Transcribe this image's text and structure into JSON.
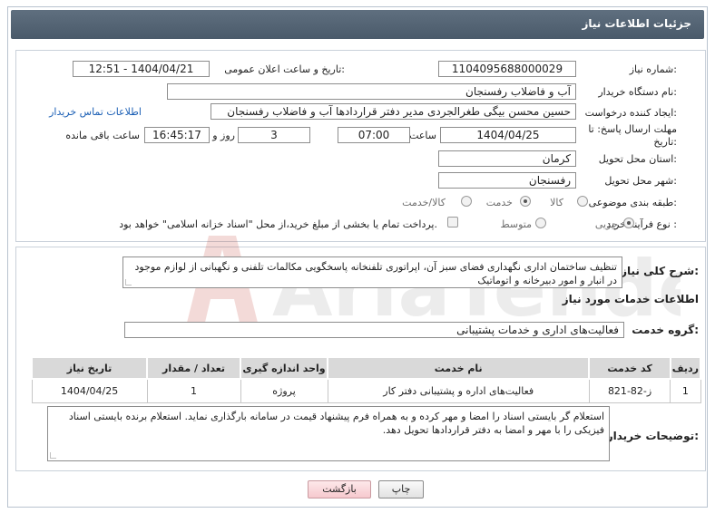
{
  "header": {
    "title": "جزئیات اطلاعات نیاز"
  },
  "form": {
    "need_number_label": "شماره نیاز:",
    "need_number": "1104095688000029",
    "announce_datetime_label": "تاریخ و ساعت اعلان عمومی:",
    "announce_datetime": "1404/04/21 - 12:51",
    "buyer_org_label": "نام دستگاه خریدار:",
    "buyer_org": "آب و فاضلاب رفسنجان",
    "requester_label": "ایجاد کننده درخواست:",
    "requester": "حسین محسن بیگی طغرالجردی مدیر دفتر قراردادها آب و فاضلاب رفسنجان",
    "contact_link": "اطلاعات تماس خریدار",
    "deadline_label": "مهلت ارسال پاسخ: تا تاریخ:",
    "deadline_date": "1404/04/25",
    "hour_label": "ساعت",
    "deadline_time": "07:00",
    "days_value": "3",
    "days_label": "روز و",
    "remaining_time": "16:45:17",
    "remaining_label": "ساعت باقی مانده",
    "province_label": "استان محل تحویل:",
    "province": "کرمان",
    "city_label": "شهر محل تحویل:",
    "city": "رفسنجان",
    "category_label": "طبقه بندی موضوعی:",
    "category_options": [
      "کالا",
      "خدمت",
      "کالا/خدمت"
    ],
    "category_selected": "خدمت",
    "process_label": "نوع فرآیند خرید :",
    "process_options": [
      "جزیی",
      "متوسط"
    ],
    "process_selected": "جزیی",
    "payment_note": "پرداخت تمام یا بخشی از مبلغ خرید،از محل \"اسناد خزانه اسلامی\" خواهد بود."
  },
  "summary": {
    "label": "شرح کلی نیاز:",
    "text": "تنظیف ساختمان اداری نگهداری فضای سبز آن، اپراتوری تلفنخانه پاسخگویی مکالمات تلفنی و نگهبانی از لوازم موجود در انبار و امور دبیرخانه و اتوماتیک"
  },
  "services": {
    "section_title": "اطلاعات خدمات مورد نیاز",
    "group_label": "گروه خدمت:",
    "group_value": "فعالیت‌های اداری و خدمات پشتیبانی",
    "table": {
      "headers": [
        "ردیف",
        "کد خدمت",
        "نام خدمت",
        "واحد اندازه گیری",
        "تعداد / مقدار",
        "تاریخ نیاز"
      ],
      "rows": [
        [
          "1",
          "ز-82-821",
          "فعالیت‌های اداره و پشتیبانی دفتر کار",
          "پروژه",
          "1",
          "1404/04/25"
        ]
      ]
    }
  },
  "buyer_notes": {
    "label": "توضیحات خریدار:",
    "text": "استعلام گر بایستی اسناد را امضا و مهر کرده و به همراه فرم پیشنهاد قیمت در سامانه بارگذاری نماید. استعلام برنده بایستی اسناد فیزیکی را با مهر و امضا به دفتر قراردادها تحویل دهد."
  },
  "buttons": {
    "print": "چاپ",
    "back": "بازگشت"
  },
  "watermark": {
    "text": "AriaTender.neT"
  }
}
